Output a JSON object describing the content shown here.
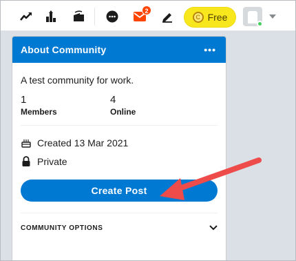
{
  "topbar": {
    "icons": [
      "trending-icon",
      "stats-icon",
      "live-icon",
      "chat-icon",
      "messages-icon",
      "create-post-pen-icon"
    ],
    "messages_badge": "2",
    "free_label": "Free",
    "coin_symbol": "C",
    "accent": "#f9e71d"
  },
  "card": {
    "title": "About Community",
    "more_label": "•••",
    "header_color": "#0079d3",
    "description": "A test community for work.",
    "stats": [
      {
        "value": "1",
        "label": "Members"
      },
      {
        "value": "4",
        "label": "Online"
      }
    ],
    "created": "Created 13 Mar 2021",
    "privacy": "Private",
    "create_post_label": "Create Post",
    "options_label": "COMMUNITY OPTIONS"
  },
  "annotation": {
    "arrow_color": "#ee4b4b"
  }
}
